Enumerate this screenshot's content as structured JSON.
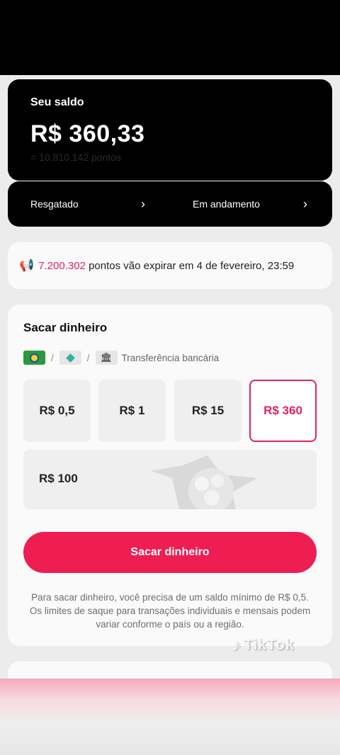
{
  "balance": {
    "label": "Seu saldo",
    "amount": "R$ 360,33",
    "points_sub": "= 10.810.142 pontos"
  },
  "status": {
    "redeemed_label": "Resgatado",
    "in_progress_label": "Em andamento"
  },
  "notice": {
    "points": "7.200.302",
    "text": " pontos vão expirar em 4 de fevereiro, 23:59"
  },
  "withdraw": {
    "title": "Sacar dinheiro",
    "method_bank_label": "Transferência bancária",
    "amounts": [
      "R$ 0,5",
      "R$ 1",
      "R$ 15",
      "R$ 360"
    ],
    "selected_amount": "R$ 360",
    "amount_wide": "R$ 100",
    "cta_label": "Sacar dinheiro",
    "hint": "Para sacar dinheiro, você precisa de um saldo mínimo de R$ 0,5. Os limites de saque para transações individuais e mensais podem variar conforme o país ou a região."
  },
  "watermark": {
    "label": "TikTok"
  },
  "colors": {
    "accent": "#ee1d52",
    "selected_border": "#e0245e",
    "card_bg": "#fafafa",
    "page_bg": "#ececec"
  },
  "icons": [
    "megaphone-icon",
    "chevron-right-icon",
    "brazil-flag-icon",
    "pix-icon",
    "bank-icon",
    "tiktok-note-icon"
  ]
}
